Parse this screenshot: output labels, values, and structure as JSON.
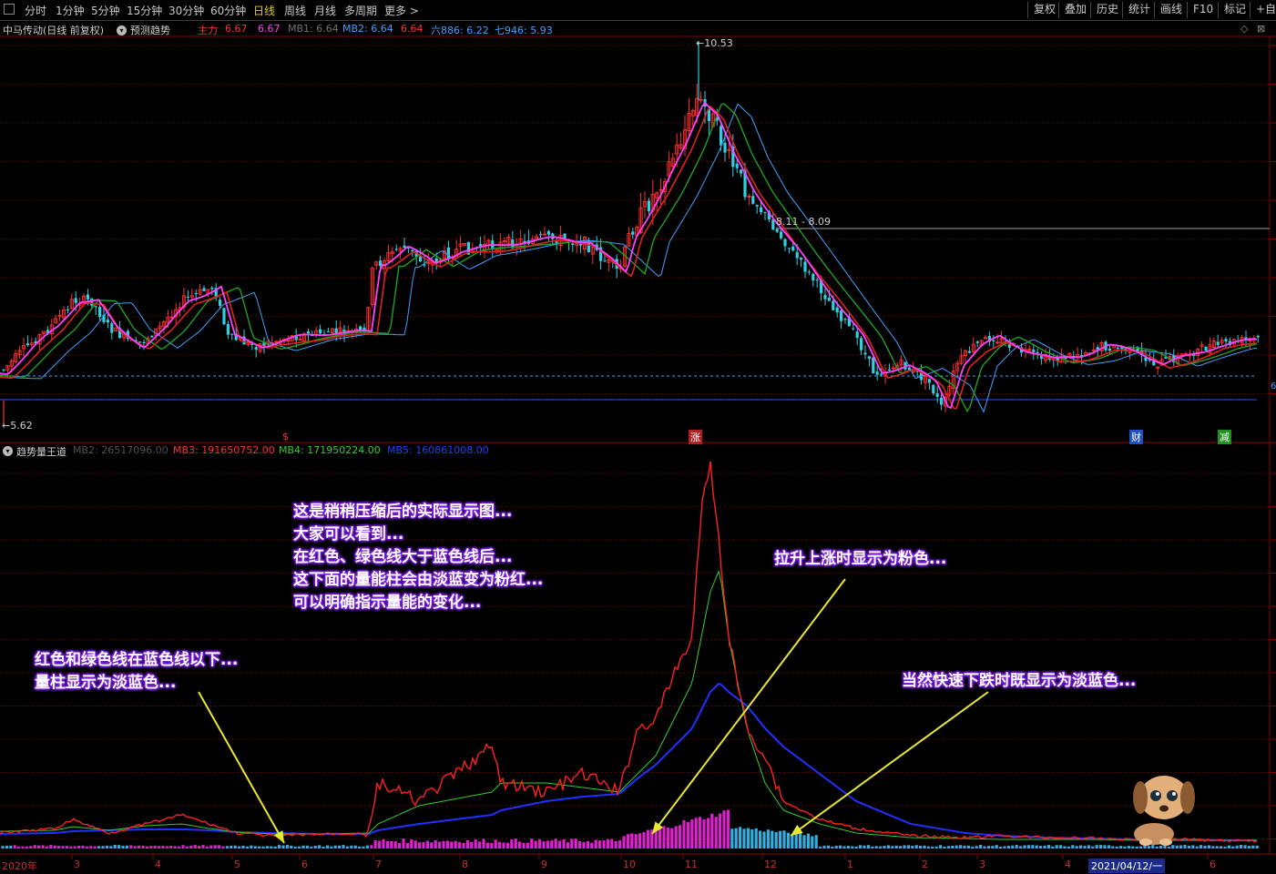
{
  "toolbar": {
    "periods": [
      "分时",
      "1分钟",
      "5分钟",
      "15分钟",
      "30分钟",
      "60分钟",
      "日线",
      "周线",
      "月线",
      "多周期",
      "更多 >"
    ],
    "active_period": "日线",
    "right_buttons": [
      "复权",
      "叠加",
      "历史",
      "统计",
      "画线",
      "F10",
      "标记",
      "+自选"
    ]
  },
  "price_panel": {
    "title": "中马传动(日线 前复权)",
    "indicator_name": "预测趋势",
    "ma_labels": [
      {
        "text": "主力",
        "color": "#ff3030"
      },
      {
        "text": "6.67",
        "color": "#ff3030"
      },
      {
        "text": "6.67",
        "color": "#ff40ff"
      },
      {
        "text": "MB1: 6.64",
        "color": "#707070"
      },
      {
        "text": "MB2: 6.64",
        "color": "#40a0ff"
      },
      {
        "text": "6.64",
        "color": "#ff3030"
      },
      {
        "text": "六886: 6.22",
        "color": "#40a0ff"
      },
      {
        "text": "七946: 5.93",
        "color": "#40a0ff"
      }
    ],
    "high_label": "10.53",
    "low_label": "5.62",
    "range_label": "8.11 - 8.09",
    "right_marker": "6",
    "event_tags": [
      {
        "text": "$",
        "color": "#ff3030"
      },
      {
        "text": "涨",
        "color": "#ff4040"
      },
      {
        "text": "财",
        "color": "#4090ff"
      },
      {
        "text": "减",
        "color": "#40d040"
      }
    ]
  },
  "volume_panel": {
    "indicator_name": "趋势量王道",
    "legend": [
      {
        "text": "MB2: 26517096.00",
        "color": "#505050"
      },
      {
        "text": "MB3: 191650752.00",
        "color": "#ff3030"
      },
      {
        "text": "MB4: 171950224.00",
        "color": "#30d030"
      },
      {
        "text": "MB5: 160861008.00",
        "color": "#2040ff"
      }
    ]
  },
  "x_axis": {
    "labels": [
      "2020年",
      "3",
      "4",
      "5",
      "6",
      "7",
      "8",
      "9",
      "10",
      "11",
      "12",
      "1",
      "2",
      "3",
      "4",
      "2021/04/12/一",
      "6"
    ]
  },
  "annotations": {
    "note_main": [
      "这是稍稍压缩后的实际显示图...",
      "大家可以看到...",
      "在红色、绿色线大于蓝色线后...",
      "这下面的量能柱会由淡蓝变为粉红...",
      "可以明确指示量能的变化..."
    ],
    "note_left": [
      "红色和绿色线在蓝色线以下...",
      "量柱显示为淡蓝色..."
    ],
    "note_rise": [
      "拉升上涨时显示为粉色..."
    ],
    "note_fall": [
      "当然快速下跌时既显示为淡蓝色..."
    ]
  },
  "colors": {
    "up": "#ff3030",
    "down": "#30d0e0",
    "ma_pink": "#ff40ff",
    "ma_green": "#20a020",
    "ma_blue": "#40a0ff",
    "vol_pink": "#e020d0",
    "vol_cyan": "#30b0e0",
    "grid": "#8b0000",
    "annot_glow": "#7a1fe0",
    "arrow": "#e8e830"
  },
  "chart_data": [
    {
      "type": "candlestick",
      "title": "中马传动(日线 前复权)",
      "x_range": [
        "2020-01",
        "2021-06"
      ],
      "key_points": {
        "high": 10.53,
        "low": 5.62,
        "range_line": [
          8.11,
          8.09
        ]
      },
      "approx_close_path": [
        {
          "x": "2020-01",
          "y": 6.1
        },
        {
          "x": "2020-02",
          "y": 7.0
        },
        {
          "x": "2020-03",
          "y": 7.3
        },
        {
          "x": "2020-04",
          "y": 7.0
        },
        {
          "x": "2020-05",
          "y": 6.7
        },
        {
          "x": "2020-06",
          "y": 6.6
        },
        {
          "x": "2020-07",
          "y": 8.2
        },
        {
          "x": "2020-08",
          "y": 8.0
        },
        {
          "x": "2020-09",
          "y": 7.9
        },
        {
          "x": "2020-10",
          "y": 8.0
        },
        {
          "x": "2020-11",
          "y": 9.8
        },
        {
          "x": "2020-12",
          "y": 8.1
        },
        {
          "x": "2021-01",
          "y": 7.0
        },
        {
          "x": "2021-02",
          "y": 6.0
        },
        {
          "x": "2021-03",
          "y": 6.6
        },
        {
          "x": "2021-04",
          "y": 6.6
        },
        {
          "x": "2021-05",
          "y": 6.6
        },
        {
          "x": "2021-06",
          "y": 6.7
        }
      ]
    },
    {
      "type": "bar",
      "title": "趋势量王道",
      "series": [
        {
          "name": "MB3",
          "values_relative": [
            0.05,
            0.06,
            0.05,
            0.04,
            0.04,
            0.12,
            0.15,
            0.14,
            0.16,
            1.0,
            0.2,
            0.05,
            0.03,
            0.03,
            0.03,
            0.02,
            0.02
          ]
        },
        {
          "name": "MB4",
          "values_relative": [
            0.04,
            0.05,
            0.05,
            0.04,
            0.04,
            0.08,
            0.12,
            0.13,
            0.14,
            0.7,
            0.25,
            0.06,
            0.03,
            0.03,
            0.03,
            0.02,
            0.02
          ]
        },
        {
          "name": "MB5",
          "values_relative": [
            0.04,
            0.04,
            0.04,
            0.04,
            0.04,
            0.05,
            0.07,
            0.09,
            0.12,
            0.42,
            0.33,
            0.18,
            0.09,
            0.05,
            0.04,
            0.03,
            0.03
          ]
        }
      ]
    }
  ]
}
